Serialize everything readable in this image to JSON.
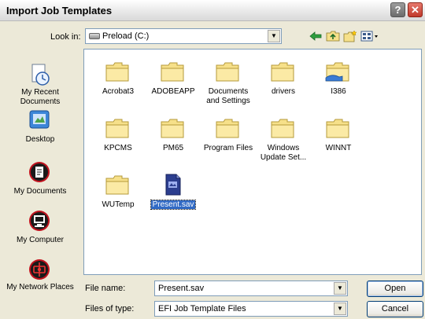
{
  "window": {
    "title": "Import Job Templates",
    "help_label": "?",
    "close_label": "✕"
  },
  "lookin": {
    "label": "Look in:",
    "value": "Preload (C:)"
  },
  "places": [
    {
      "label": "My Recent Documents",
      "icon": "recent-documents-icon"
    },
    {
      "label": "Desktop",
      "icon": "desktop-icon"
    },
    {
      "label": "My Documents",
      "icon": "my-documents-icon"
    },
    {
      "label": "My Computer",
      "icon": "my-computer-icon"
    },
    {
      "label": "My Network Places",
      "icon": "network-places-icon"
    }
  ],
  "files": [
    {
      "name": "Acrobat3",
      "type": "folder"
    },
    {
      "name": "ADOBEAPP",
      "type": "folder"
    },
    {
      "name": "Documents and Settings",
      "type": "folder"
    },
    {
      "name": "drivers",
      "type": "folder"
    },
    {
      "name": "I386",
      "type": "folder-shared"
    },
    {
      "name": "KPCMS",
      "type": "folder"
    },
    {
      "name": "PM65",
      "type": "folder"
    },
    {
      "name": "Program Files",
      "type": "folder"
    },
    {
      "name": "Windows Update Set...",
      "type": "folder"
    },
    {
      "name": "WINNT",
      "type": "folder"
    },
    {
      "name": "WUTemp",
      "type": "folder"
    },
    {
      "name": "Present.sav",
      "type": "file",
      "selected": true
    }
  ],
  "filename": {
    "label": "File name:",
    "value": "Present.sav"
  },
  "filetype": {
    "label": "Files of type:",
    "value": "EFI Job Template Files"
  },
  "buttons": {
    "open": "Open",
    "cancel": "Cancel"
  },
  "colors": {
    "selection": "#316ac5",
    "folder": "#f6e08a",
    "titlebar": "#e9e9e9"
  }
}
